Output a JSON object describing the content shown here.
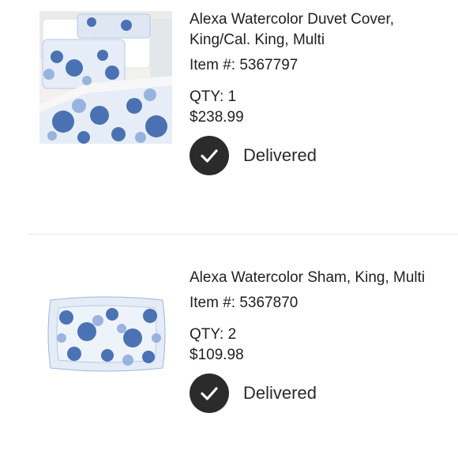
{
  "items": [
    {
      "title": "Alexa Watercolor Duvet Cover, King/Cal. King, Multi",
      "item_number": "Item #: 5367797",
      "qty": "QTY: 1",
      "price": "$238.99",
      "status": "Delivered",
      "image_icon": "duvet-bedding-photo"
    },
    {
      "title": "Alexa Watercolor Sham, King, Multi",
      "item_number": "Item #: 5367870",
      "qty": "QTY: 2",
      "price": "$109.98",
      "status": "Delivered",
      "image_icon": "pillow-sham-photo"
    }
  ],
  "colors": {
    "status_icon_bg": "#2b2b2b",
    "print_blue": "#2f5da8",
    "divider": "#e6e6e6"
  }
}
